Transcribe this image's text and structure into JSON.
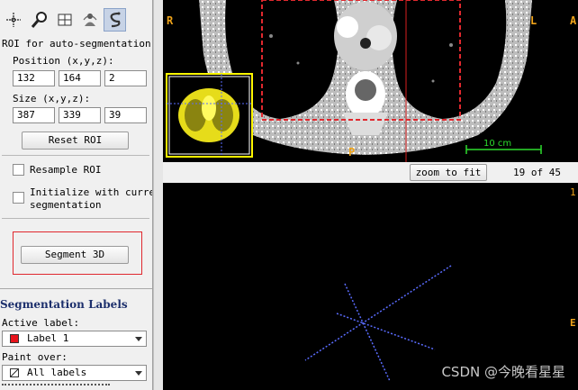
{
  "toolbar": {
    "tools": [
      {
        "name": "crosshair-tool",
        "icon": "crosshair-icon"
      },
      {
        "name": "zoom-tool",
        "icon": "magnifier-icon"
      },
      {
        "name": "window-tool",
        "icon": "grid-icon"
      },
      {
        "name": "paintbrush-tool",
        "icon": "person-icon"
      },
      {
        "name": "snake-tool",
        "icon": "snake-icon"
      }
    ]
  },
  "roi": {
    "title": "ROI for auto-segmentation:",
    "position_label": "Position (x,y,z):",
    "position": [
      "132",
      "164",
      "2"
    ],
    "size_label": "Size (x,y,z):",
    "size": [
      "387",
      "339",
      "39"
    ],
    "reset_label": "Reset ROI",
    "resample_label": "Resample ROI",
    "init_label_line1": "Initialize with currer",
    "init_label_line2": "segmentation"
  },
  "segment_button": "Segment 3D",
  "labels": {
    "title": "Segmentation Labels",
    "active_label_caption": "Active label:",
    "active_label": "Label 1",
    "active_color": "#e8141c",
    "paint_over_caption": "Paint over:",
    "paint_over": "All labels"
  },
  "ct_view": {
    "left_orient": "R",
    "right_orient": "L",
    "bottom_orient": "P",
    "right_edge_orient": "A",
    "scale_label": "10 cm"
  },
  "status": {
    "zoom_button": "zoom to fit",
    "slice_text": "19 of 45"
  },
  "view3d": {
    "right_edge_top": "1",
    "right_edge_mid": "E"
  },
  "watermark": "CSDN @今晚看星星"
}
